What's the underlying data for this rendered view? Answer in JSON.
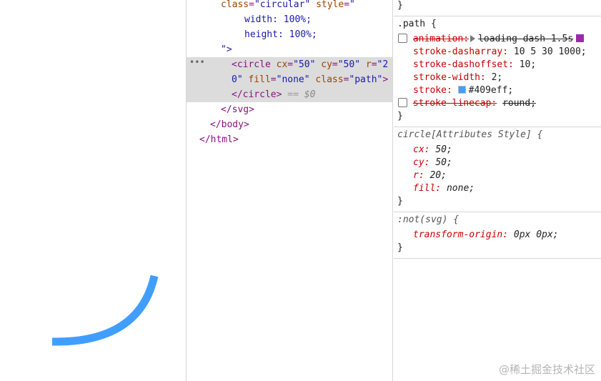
{
  "preview": {
    "arc_color": "#409eff"
  },
  "elements": {
    "line1": {
      "attr1": "class",
      "val1": "\"circular\"",
      "attr2": "style",
      "val2": "\""
    },
    "line2": "width: 100%;",
    "line3": "height: 100%;",
    "line4": "\">",
    "line5": {
      "open": "<circle",
      "a1": "cx",
      "v1": "\"50\"",
      "a2": "cy",
      "v2": "\"50\"",
      "a3": "r",
      "v3": "\"2"
    },
    "line6": {
      "cont": "0\"",
      "a4": "fill",
      "v4": "\"none\"",
      "a5": "class",
      "v5": "\"path\"",
      "close": ">"
    },
    "line7": {
      "tag": "</circle>",
      "eq": "==",
      "ref": "$0"
    },
    "line8": "</svg>",
    "line9": "</body>",
    "line10": "</html>",
    "dots": "•••"
  },
  "styles": {
    "top_brace": "}",
    "path_rule": {
      "selector": ".path {",
      "animation_prop": "animation:",
      "animation_val": "loading-dash 1.5s",
      "dasharray_prop": "stroke-dasharray:",
      "dasharray_val": "10 5 30 1000;",
      "dashoffset_prop": "stroke-dashoffset:",
      "dashoffset_val": "10;",
      "width_prop": "stroke-width:",
      "width_val": "2;",
      "stroke_prop": "stroke:",
      "stroke_val": "#409eff;",
      "stroke_color": "#409eff",
      "linecap_prop": "stroke-linecap:",
      "linecap_val": "round;",
      "close": "}"
    },
    "attr_rule": {
      "selector": "circle[Attributes Style] {",
      "cx_prop": "cx:",
      "cx_val": "50;",
      "cy_prop": "cy:",
      "cy_val": "50;",
      "r_prop": "r:",
      "r_val": "20;",
      "fill_prop": "fill:",
      "fill_val": "none;",
      "close": "}"
    },
    "notsvg_rule": {
      "selector": ":not(svg) {",
      "to_prop": "transform-origin:",
      "to_val": "0px 0px;",
      "close": "}"
    }
  },
  "watermark": "@稀土掘金技术社区"
}
